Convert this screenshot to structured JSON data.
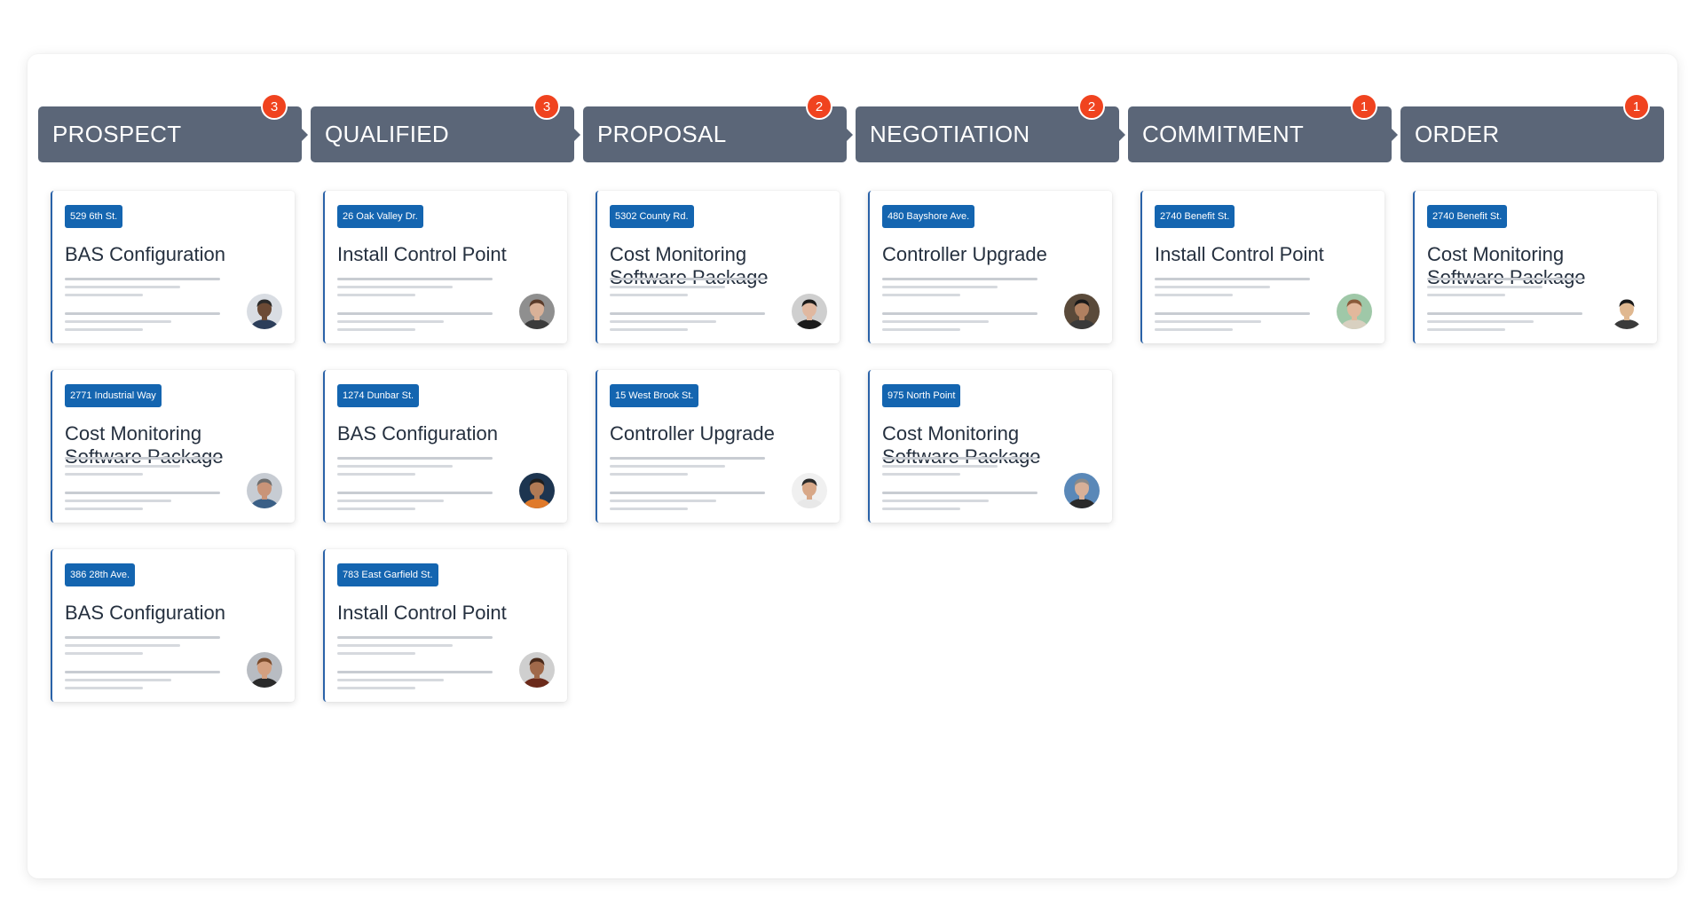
{
  "stages": [
    {
      "label": "PROSPECT",
      "count": "3"
    },
    {
      "label": "QUALIFIED",
      "count": "3"
    },
    {
      "label": "PROPOSAL",
      "count": "2"
    },
    {
      "label": "NEGOTIATION",
      "count": "2"
    },
    {
      "label": "COMMITMENT",
      "count": "1"
    },
    {
      "label": "ORDER",
      "count": "1"
    }
  ],
  "columns": [
    {
      "cards": [
        {
          "address": "529 6th St.",
          "title": "BAS Configuration",
          "avatar": {
            "bg": "#d9dde3",
            "skin": "#6b4a35",
            "hair": "#2a2a2a",
            "shirt": "#2c3e5a"
          }
        },
        {
          "address": "2771 Industrial Way",
          "title": "Cost Monitoring Software Package",
          "avatar": {
            "bg": "#c7ccd3",
            "skin": "#c99478",
            "hair": "#6e6e6e",
            "shirt": "#3a5f86"
          }
        },
        {
          "address": "386 28th Ave.",
          "title": "BAS Configuration",
          "avatar": {
            "bg": "#b8bcc2",
            "skin": "#d4a080",
            "hair": "#7a4a2a",
            "shirt": "#2a2a2a"
          }
        }
      ]
    },
    {
      "cards": [
        {
          "address": "26 Oak Valley Dr.",
          "title": "Install Control Point",
          "avatar": {
            "bg": "#8f8f8f",
            "skin": "#d9b198",
            "hair": "#5a3b2a",
            "shirt": "#3b3b3b"
          }
        },
        {
          "address": "1274 Dunbar St.",
          "title": "BAS Configuration",
          "avatar": {
            "bg": "#1d3550",
            "skin": "#b07a55",
            "hair": "#1e1e1e",
            "shirt": "#e07a2a"
          }
        },
        {
          "address": "783 East Garfield St.",
          "title": "Install Control Point",
          "avatar": {
            "bg": "#cfcfcf",
            "skin": "#a0694a",
            "hair": "#4a2a1a",
            "shirt": "#6b2a1a"
          }
        }
      ]
    },
    {
      "cards": [
        {
          "address": "5302 County Rd.",
          "title": "Cost Monitoring Software Package",
          "avatar": {
            "bg": "#cfcfcf",
            "skin": "#e0b8a0",
            "hair": "#1a1a1a",
            "shirt": "#1a1a1a"
          }
        },
        {
          "address": "15 West Brook St.",
          "title": "Controller Upgrade",
          "avatar": {
            "bg": "#f0f0f0",
            "skin": "#d8a888",
            "hair": "#2a2a2a",
            "shirt": "#e8e8e8"
          }
        }
      ]
    },
    {
      "cards": [
        {
          "address": "480 Bayshore Ave.",
          "title": "Controller Upgrade",
          "avatar": {
            "bg": "#5a4a3a",
            "skin": "#b08060",
            "hair": "#1a1a1a",
            "shirt": "#3a3a3a"
          }
        },
        {
          "address": "975 North Point",
          "title": "Cost Monitoring Software Package",
          "avatar": {
            "bg": "#5a88b8",
            "skin": "#d8b098",
            "hair": "#8a8a8a",
            "shirt": "#2a2a2a"
          }
        }
      ]
    },
    {
      "cards": [
        {
          "address": "2740 Benefit St.",
          "title": "Install Control Point",
          "avatar": {
            "bg": "#9fc8a8",
            "skin": "#e2b89c",
            "hair": "#8a5a3a",
            "shirt": "#d8d0c0"
          }
        }
      ]
    },
    {
      "cards": [
        {
          "address": "2740 Benefit St.",
          "title": "Cost Monitoring Software Package",
          "avatar": {
            "bg": "#ffffff",
            "skin": "#e0b890",
            "hair": "#1a1a1a",
            "shirt": "#3a3a3a"
          }
        }
      ]
    }
  ]
}
